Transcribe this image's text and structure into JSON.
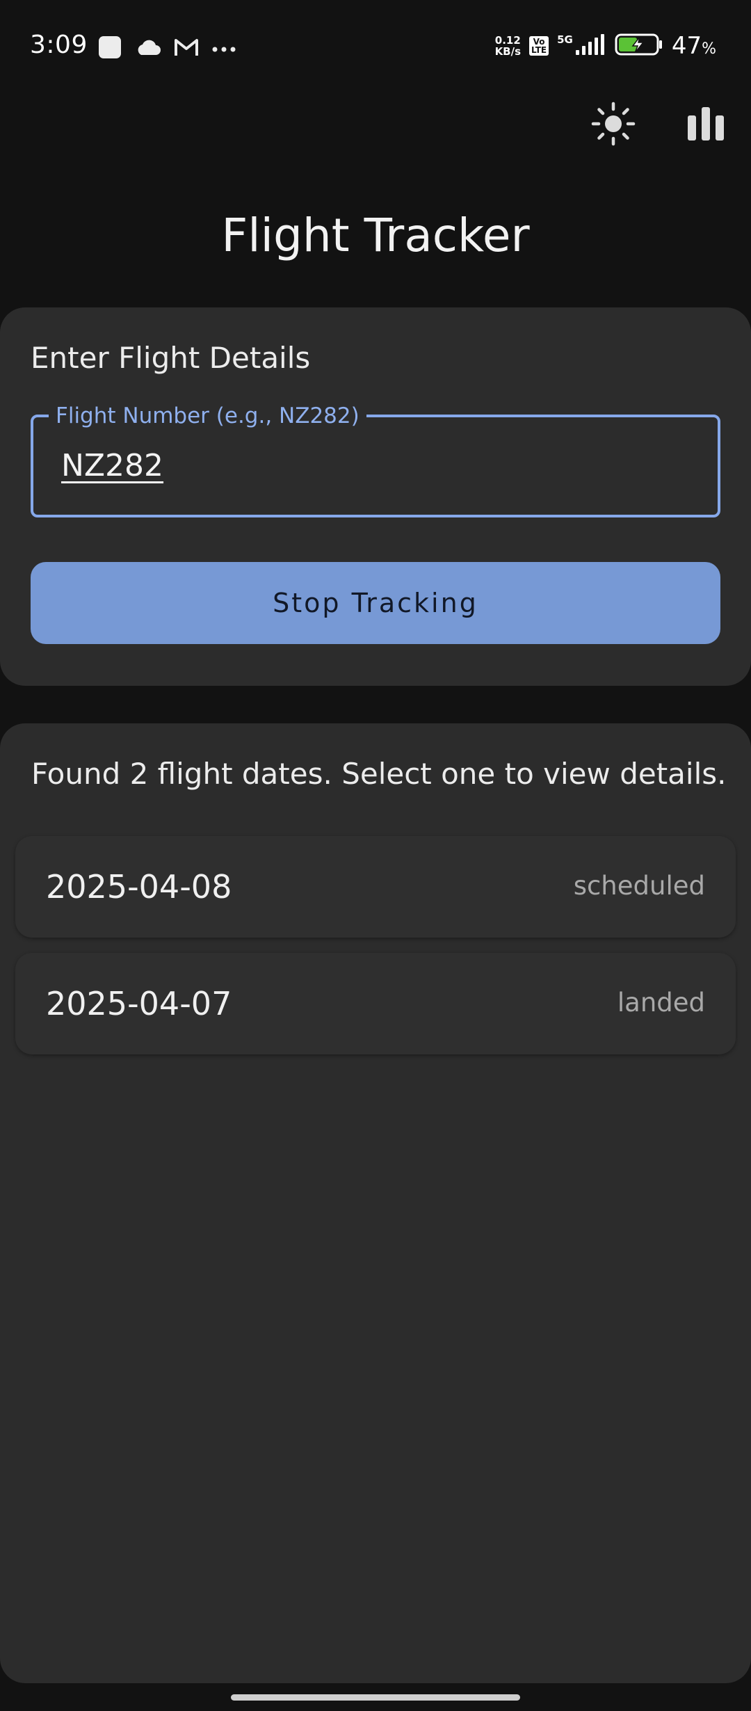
{
  "status_bar": {
    "time": "3:09",
    "net_speed_value": "0.12",
    "net_speed_unit": "KB/s",
    "volte_top": "Vo",
    "volte_bottom": "LTE",
    "network": "5G",
    "battery_percent": "47",
    "battery_unit": "%",
    "icons": [
      "app-notification-icon",
      "cloud-icon",
      "gmail-icon",
      "more-icon",
      "signal-icon",
      "battery-charging-icon"
    ]
  },
  "toolbar": {
    "theme_icon": "sun-icon",
    "stats_icon": "bar-chart-icon"
  },
  "app": {
    "title": "Flight Tracker"
  },
  "details_card": {
    "heading": "Enter Flight Details",
    "field_label": "Flight Number (e.g., NZ282)",
    "field_value": "NZ282",
    "button_label": "Stop Tracking"
  },
  "results": {
    "summary": "Found 2 flight dates. Select one to view details.",
    "dates": [
      {
        "date": "2025-04-08",
        "status": "scheduled"
      },
      {
        "date": "2025-04-07",
        "status": "landed"
      }
    ]
  },
  "colors": {
    "background": "#121212",
    "card": "#2c2c2c",
    "accent": "#7799d5",
    "field_border": "#86a8ea"
  }
}
